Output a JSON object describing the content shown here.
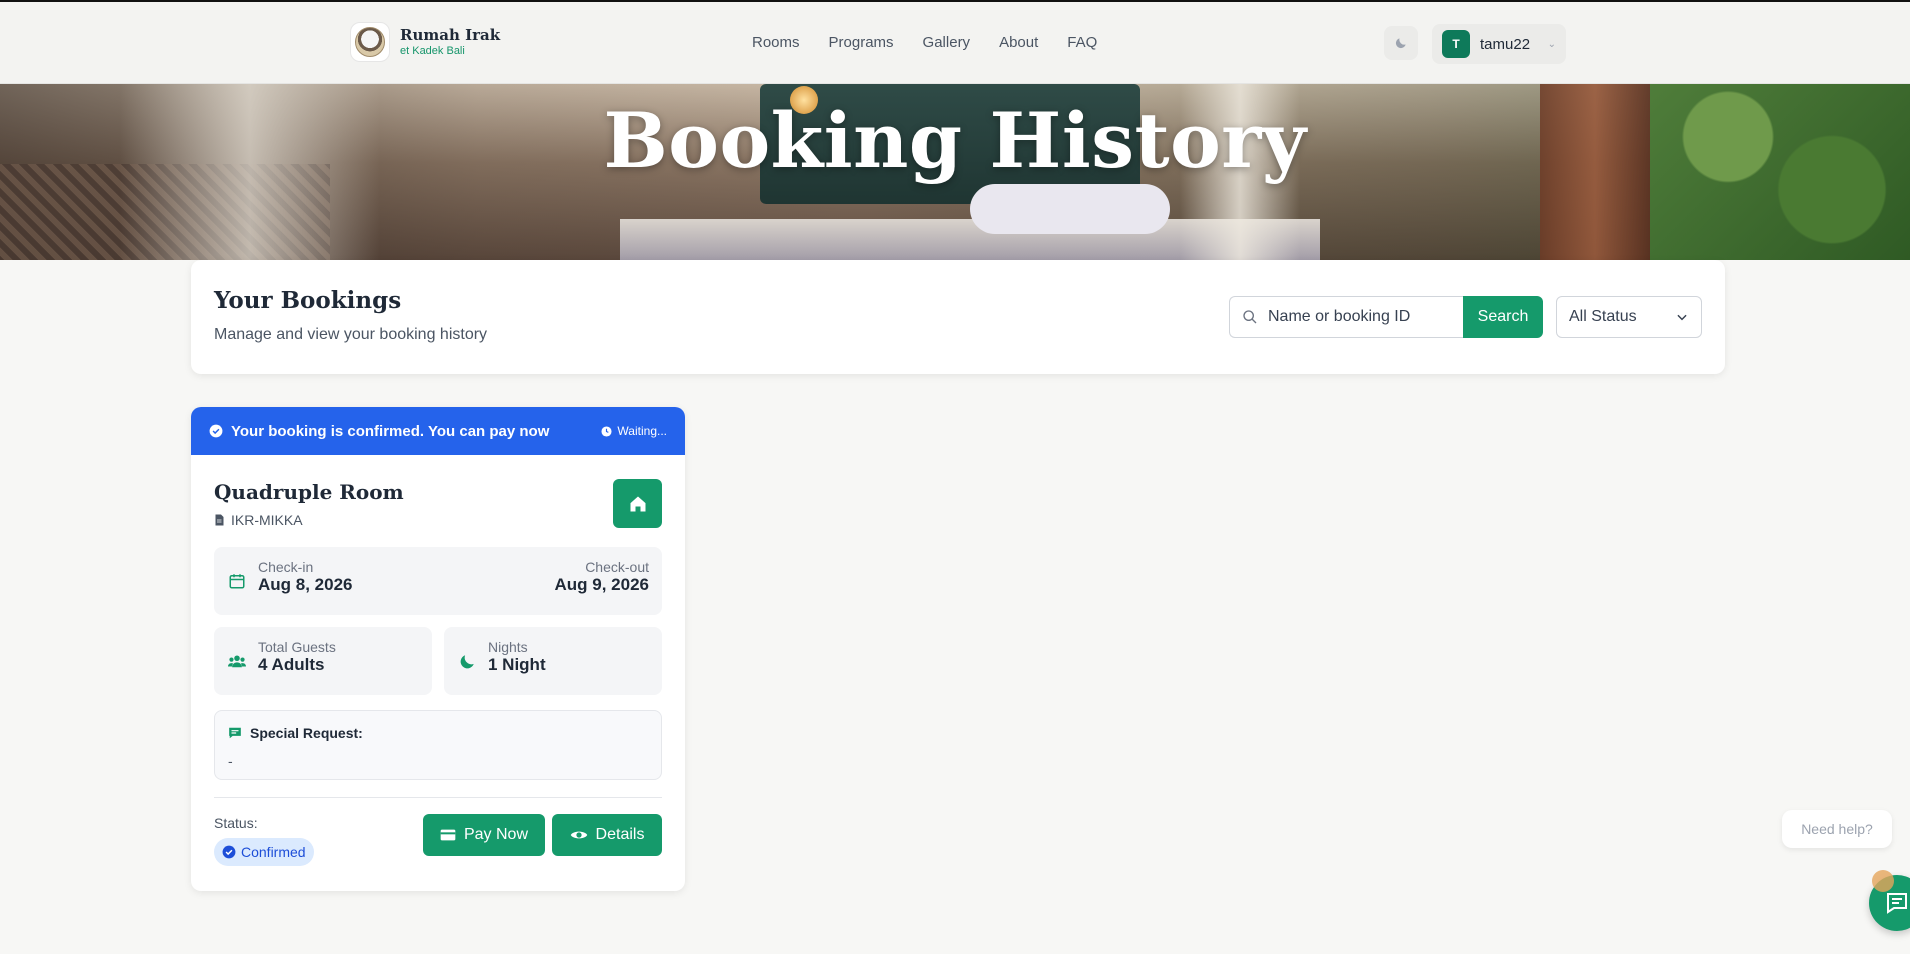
{
  "header": {
    "brand_name": "Rumah Irak",
    "brand_sub": "et Kadek Bali",
    "nav": [
      "Rooms",
      "Programs",
      "Gallery",
      "About",
      "FAQ"
    ],
    "user": {
      "initial": "T",
      "name": "tamu22"
    }
  },
  "hero": {
    "title": "Booking History"
  },
  "panel": {
    "title": "Your Bookings",
    "subtitle": "Manage and view your booking history",
    "search_placeholder": "Name or booking ID",
    "search_button": "Search",
    "status_filter": "All Status"
  },
  "booking": {
    "banner_message": "Your booking is confirmed. You can pay now",
    "banner_status": "Waiting...",
    "room_name": "Quadruple Room",
    "booking_code": "IKR-MIKKA",
    "checkin_label": "Check-in",
    "checkin_date": "Aug 8, 2026",
    "checkout_label": "Check-out",
    "checkout_date": "Aug 9, 2026",
    "guests_label": "Total Guests",
    "guests_value": "4 Adults",
    "nights_label": "Nights",
    "nights_value": "1 Night",
    "request_label": "Special Request:",
    "request_value": "-",
    "status_label": "Status:",
    "status_value": "Confirmed",
    "pay_button": "Pay Now",
    "details_button": "Details"
  },
  "help": {
    "tooltip": "Need help?"
  },
  "colors": {
    "primary_green": "#159a6b",
    "banner_blue": "#2563eb",
    "badge_blue_bg": "#dbeafe"
  }
}
